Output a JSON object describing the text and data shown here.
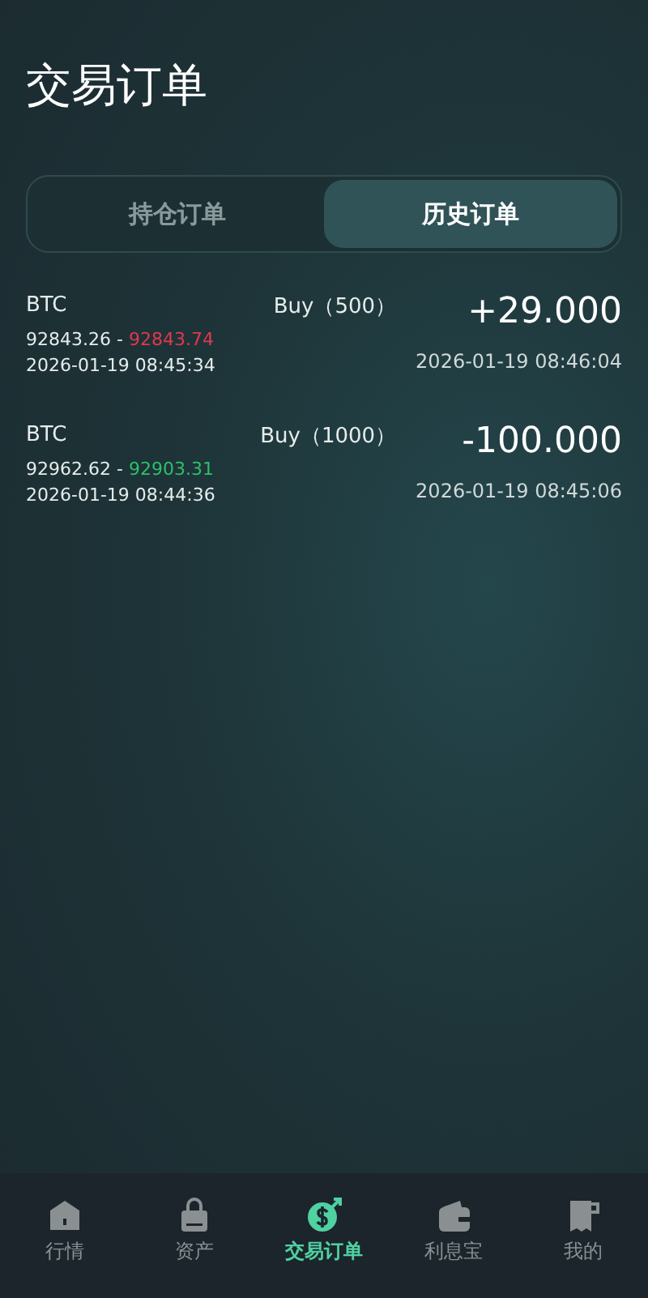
{
  "title": "交易订单",
  "tabs": [
    {
      "label": "持仓订单",
      "selected": false
    },
    {
      "label": "历史订单",
      "selected": true
    }
  ],
  "orders": [
    {
      "symbol": "BTC",
      "side": "Buy（500）",
      "open_price": "92843.26",
      "separator": "-",
      "close_price": "92843.74",
      "color": "#e0384f",
      "open_time": "2026-01-19 08:45:34",
      "profit": "+29.000",
      "close_time": "2026-01-19 08:46:04"
    },
    {
      "symbol": "BTC",
      "side": "Buy（1000）",
      "open_price": "92962.62",
      "separator": "-",
      "close_price": "92903.31",
      "color": "#2fbf6a",
      "open_time": "2026-01-19 08:44:36",
      "profit": "-100.000",
      "close_time": "2026-01-19 08:45:06"
    }
  ],
  "nav": [
    {
      "label": "行情",
      "selected": false
    },
    {
      "label": "资产",
      "selected": false
    },
    {
      "label": "交易订单",
      "selected": true
    },
    {
      "label": "利息宝",
      "selected": false
    },
    {
      "label": "我的",
      "selected": false
    }
  ]
}
